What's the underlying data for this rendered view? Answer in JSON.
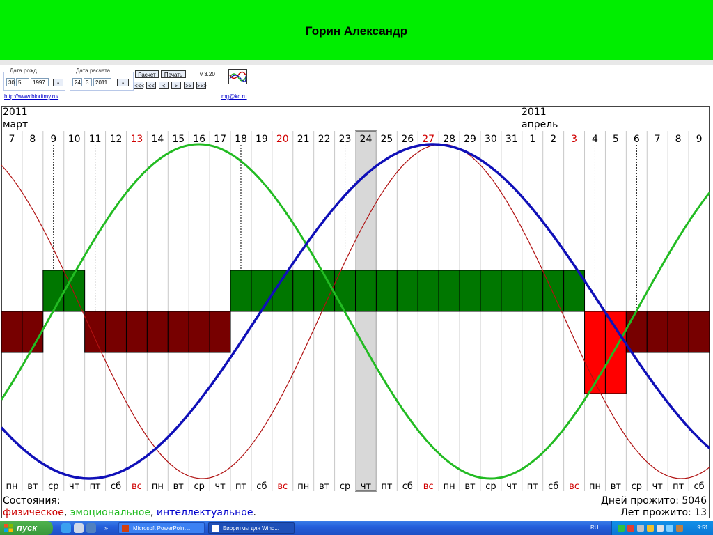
{
  "header": {
    "title": "Горин Александр"
  },
  "toolbar": {
    "birth_group_title": "Дата рожд.",
    "birth_day": "30",
    "birth_month": "5",
    "birth_year": "1997",
    "calc_group_title": "Дата расчета",
    "calc_day": "24",
    "calc_month": "3",
    "calc_year": "2011",
    "calc_button": "Расчет",
    "print_button": "Печать",
    "version": "v 3.20",
    "nav": [
      "<<<",
      "<<",
      "<",
      ">",
      ">>",
      ">>>"
    ],
    "site_link": "http://www.bioritmy.ru/",
    "mail_link": "mg@kc.ru"
  },
  "chart_data": {
    "type": "line",
    "year_left": "2011",
    "month_left": "март",
    "year_right": "2011",
    "month_right": "апрель",
    "days": [
      "7",
      "8",
      "9",
      "10",
      "11",
      "12",
      "13",
      "14",
      "15",
      "16",
      "17",
      "18",
      "19",
      "20",
      "21",
      "22",
      "23",
      "24",
      "25",
      "26",
      "27",
      "28",
      "29",
      "30",
      "31",
      "1",
      "2",
      "3",
      "4",
      "5",
      "6",
      "7",
      "8",
      "9"
    ],
    "weekdays": [
      "пн",
      "вт",
      "ср",
      "чт",
      "пт",
      "сб",
      "вс",
      "пн",
      "вт",
      "ср",
      "чт",
      "пт",
      "сб",
      "вс",
      "пн",
      "вт",
      "ср",
      "чт",
      "пт",
      "сб",
      "вс",
      "пн",
      "вт",
      "ср",
      "чт",
      "пт",
      "сб",
      "вс",
      "пн",
      "вт",
      "ср",
      "чт",
      "пт",
      "сб"
    ],
    "highlight_index": 17,
    "ylim": [
      -1,
      1
    ],
    "series": [
      {
        "name": "физическое",
        "color": "#b01010",
        "period": 23,
        "values": [
          0.8,
          0.63,
          0.4,
          0.14,
          -0.14,
          -0.4,
          -0.63,
          -0.82,
          -0.94,
          -1.0,
          -0.98,
          -0.89,
          -0.73,
          -0.52,
          -0.27,
          0.0,
          0.27,
          0.52,
          0.73,
          0.89,
          0.98,
          1.0,
          0.94,
          0.82,
          0.63,
          0.4,
          0.14,
          -0.14,
          -0.4,
          -0.63,
          -0.82,
          -0.94,
          -1.0,
          -0.98
        ]
      },
      {
        "name": "эмоциональное",
        "color": "#22bb22",
        "period": 28,
        "values": [
          -0.43,
          -0.22,
          0.0,
          0.22,
          0.43,
          0.62,
          0.78,
          0.9,
          0.97,
          1.0,
          0.97,
          0.9,
          0.78,
          0.62,
          0.43,
          0.22,
          0.0,
          -0.22,
          -0.43,
          -0.62,
          -0.78,
          -0.9,
          -0.97,
          -1.0,
          -0.97,
          -0.9,
          -0.78,
          -0.62,
          -0.43,
          -0.22,
          0.0,
          0.22,
          0.43,
          0.62
        ]
      },
      {
        "name": "интеллектуальное",
        "color": "#1010b8",
        "period": 33,
        "values": [
          -0.76,
          -0.87,
          -0.95,
          -0.99,
          -1.0,
          -0.97,
          -0.91,
          -0.81,
          -0.69,
          -0.54,
          -0.37,
          -0.19,
          0.0,
          0.19,
          0.37,
          0.54,
          0.69,
          0.81,
          0.91,
          0.97,
          1.0,
          0.99,
          0.95,
          0.87,
          0.76,
          0.62,
          0.46,
          0.28,
          0.1,
          -0.1,
          -0.28,
          -0.46,
          -0.62,
          -0.76
        ]
      }
    ],
    "states": [
      -1,
      -1,
      1,
      1,
      -1,
      -1,
      -1,
      -1,
      -1,
      -1,
      -1,
      1,
      1,
      1,
      1,
      1,
      1,
      1,
      1,
      1,
      1,
      1,
      1,
      1,
      1,
      1,
      1,
      1,
      -2,
      -2,
      -1,
      -1,
      -1,
      -1
    ],
    "critical_indices": [
      2,
      4,
      11,
      16,
      28,
      30
    ],
    "legend_label": "Состояния:",
    "legend_items": [
      {
        "text": "физическое",
        "color": "#cc0000"
      },
      {
        "text": ", ",
        "color": "#000000"
      },
      {
        "text": "эмоциональное",
        "color": "#22bb22"
      },
      {
        "text": ", ",
        "color": "#000000"
      },
      {
        "text": "интеллектуальное",
        "color": "#0000cc"
      },
      {
        "text": ".",
        "color": "#000000"
      }
    ],
    "days_lived": "Дней прожито: 5046",
    "years_lived": "Лет прожито: 13",
    "colors": {
      "positive": "#007700",
      "negative": "#770000",
      "critical_low": "#ff0000",
      "today": "#d8d8d8",
      "red_day": "#d00000"
    }
  },
  "taskbar": {
    "start_label": "пуск",
    "tasks": [
      "Microsoft PowerPoint ...",
      "Биоритмы для Wind..."
    ],
    "lang": "RU",
    "clock": "9:51"
  }
}
